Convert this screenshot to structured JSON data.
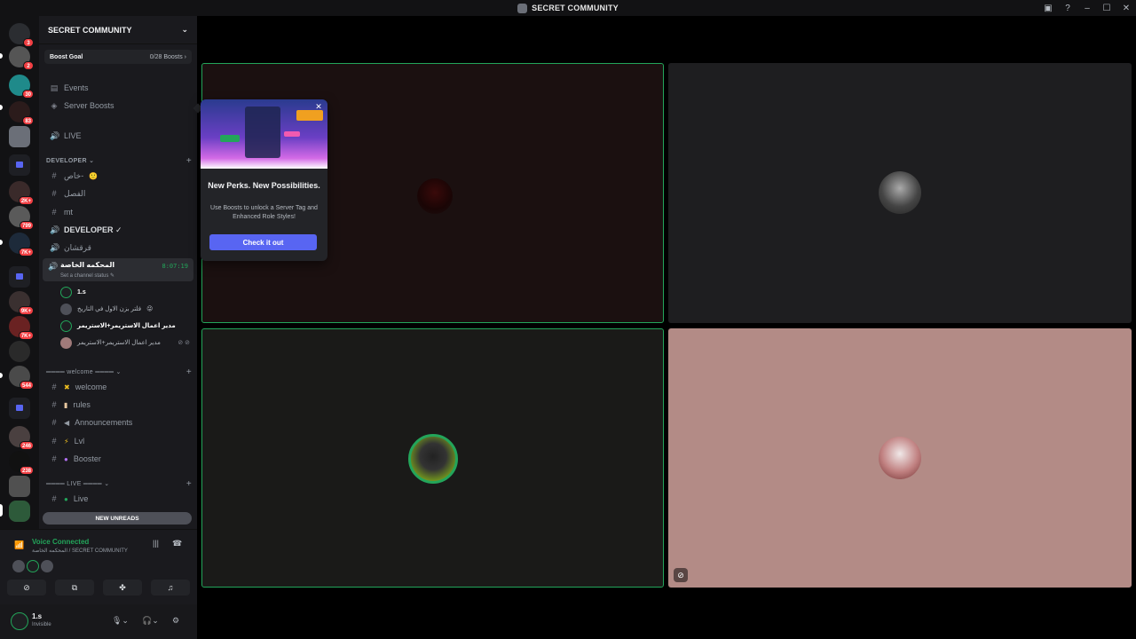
{
  "window": {
    "title": "SECRET COMMUNITY"
  },
  "rail": {
    "badges": [
      "3",
      "2",
      "30",
      "83",
      "2K+",
      "799",
      "7K+",
      "9K+",
      "7K+",
      "544",
      "246",
      "238"
    ]
  },
  "server": {
    "name": "SECRET COMMUNITY",
    "boost_goal_label": "Boost Goal",
    "boost_goal_value": "0/28 Boosts"
  },
  "sidebar": {
    "events": "Events",
    "server_boosts": "Server Boosts",
    "live_voice": "LIVE",
    "cat_developer": "DEVELOPER",
    "ch_khas": "خاص-",
    "ch_fasl": "الفصل",
    "ch_mt": "mt",
    "ch_developer_check": "DEVELOPER ✓",
    "ch_qarqashan": "قرقشان",
    "active_voice_name": "المحكمه الخاصة",
    "active_voice_status": "Set a channel status",
    "active_voice_timer": "8:07:19",
    "members": [
      "1.s",
      "فلتر بزن الاول في التاريخ",
      "مدير اعمال الاستريمر+الاستريمر",
      "مدير اعمال الاستريمر+الاستريمر"
    ],
    "cat_welcome": "════ welcome ════",
    "ch_welcome": "welcome",
    "ch_rules": "rules",
    "ch_announcements": "Announcements",
    "ch_lvl": "Lvl",
    "ch_booster": "Booster",
    "cat_live": "════ LIVE ════",
    "ch_live": "Live",
    "new_unreads": "NEW UNREADS"
  },
  "voice": {
    "status": "Voice Connected",
    "location": "المحكمه الخاصة / SECRET COMMUNITY"
  },
  "user": {
    "name": "1.s",
    "status": "Invisible"
  },
  "popup": {
    "title": "New Perks. New Possibilities.",
    "description": "Use Boosts to unlock a Server Tag and Enhanced Role Styles!",
    "button": "Check it out"
  },
  "colors": {
    "accent": "#5865f2",
    "speaking": "#23a55a",
    "badge": "#f23f43",
    "tile_pink": "#b38b86"
  }
}
